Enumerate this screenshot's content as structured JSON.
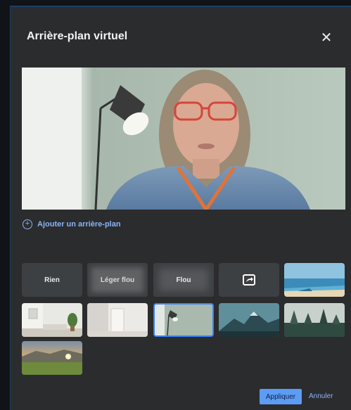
{
  "dialog": {
    "title": "Arrière-plan virtuel",
    "close_icon": "close-icon"
  },
  "preview": {
    "description_icon": "camera-preview"
  },
  "add_background": {
    "label": "Ajouter un arrière-plan",
    "icon": "plus-circle-icon"
  },
  "options": {
    "none": "Rien",
    "light_blur": "Léger flou",
    "blur": "Flou",
    "upload_icon": "share-screen-icon"
  },
  "backgrounds": [
    "beach",
    "living-room",
    "white-hallway",
    "green-wall-lamp",
    "mountains",
    "foggy-forest",
    "sunset-hills"
  ],
  "selected_background": "green-wall-lamp",
  "footer": {
    "apply": "Appliquer",
    "cancel": "Annuler"
  },
  "colors": {
    "accent": "#8ab4f8",
    "apply_button": "#5c9cf5",
    "dialog_bg": "#2b2c2e",
    "selection": "#3b82f6"
  }
}
